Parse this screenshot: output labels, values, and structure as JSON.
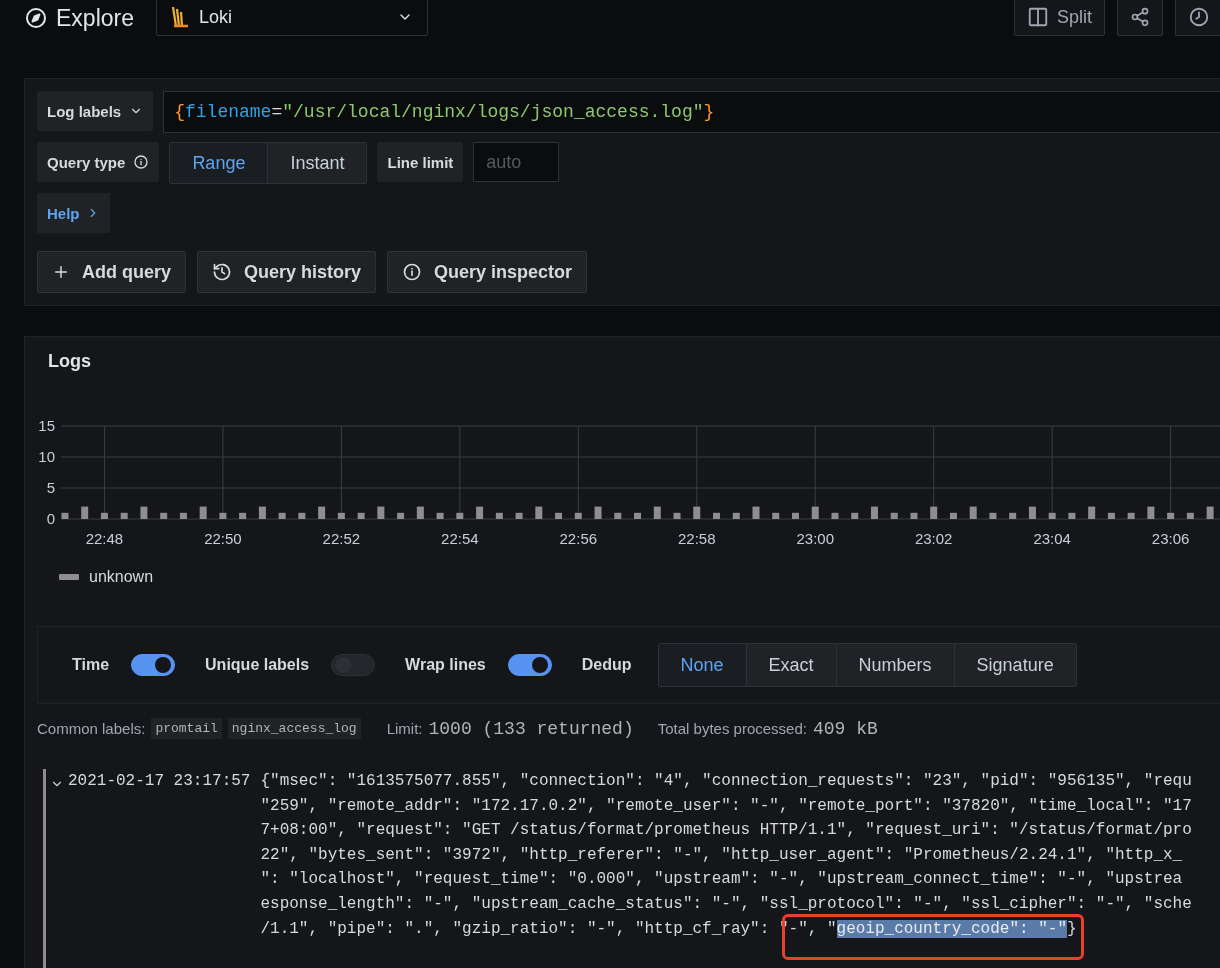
{
  "topbar": {
    "title": "Explore",
    "datasource": "Loki",
    "actions": [
      {
        "kind": "split",
        "label": "Split"
      },
      {
        "kind": "share"
      },
      {
        "kind": "clock"
      }
    ]
  },
  "query": {
    "labels_button": "Log labels",
    "expression": [
      {
        "kind": "brace",
        "text": "{"
      },
      {
        "kind": "key",
        "text": "filename"
      },
      {
        "kind": "op",
        "text": "="
      },
      {
        "kind": "string",
        "text": "\"/usr/local/nginx/logs/json_access.log\""
      },
      {
        "kind": "brace",
        "text": "}"
      }
    ],
    "query_type_label": "Query type",
    "query_types": [
      {
        "label": "Range",
        "selected": true
      },
      {
        "label": "Instant",
        "selected": false
      }
    ],
    "line_limit_label": "Line limit",
    "line_limit_placeholder": "auto",
    "help": "Help"
  },
  "query_buttons": [
    {
      "kind": "add",
      "label": "Add query"
    },
    {
      "kind": "history",
      "label": "Query history"
    },
    {
      "kind": "info",
      "label": "Query inspector"
    }
  ],
  "logs": {
    "title": "Logs",
    "chart_data": {
      "type": "bar",
      "grid": true,
      "ylim": [
        0,
        15
      ],
      "yticks": [
        0,
        5,
        10,
        15
      ],
      "categories": [
        null,
        null,
        "22:48",
        null,
        null,
        null,
        null,
        null,
        "22:50",
        null,
        null,
        null,
        null,
        null,
        "22:52",
        null,
        null,
        null,
        null,
        null,
        "22:54",
        null,
        null,
        null,
        null,
        null,
        "22:56",
        null,
        null,
        null,
        null,
        null,
        "22:58",
        null,
        null,
        null,
        null,
        null,
        "23:00",
        null,
        null,
        null,
        null,
        null,
        "23:02",
        null,
        null,
        null,
        null,
        null,
        "23:04",
        null,
        null,
        null,
        null,
        null,
        "23:06",
        null,
        null
      ],
      "series": [
        {
          "name": "unknown",
          "color": "#8e8e8e",
          "values": [
            1,
            2,
            1,
            1,
            2,
            1,
            1,
            2,
            1,
            1,
            2,
            1,
            1,
            2,
            1,
            1,
            2,
            1,
            2,
            1,
            1,
            2,
            1,
            1,
            2,
            1,
            1,
            2,
            1,
            1,
            2,
            1,
            2,
            1,
            1,
            2,
            1,
            1,
            2,
            1,
            1,
            2,
            1,
            1,
            2,
            1,
            2,
            1,
            1,
            2,
            1,
            1,
            2,
            1,
            1,
            2,
            1,
            1,
            2
          ]
        }
      ]
    },
    "options": [
      {
        "label": "Time",
        "on": true
      },
      {
        "label": "Unique labels",
        "on": false
      },
      {
        "label": "Wrap lines",
        "on": true
      }
    ],
    "dedup_label": "Dedup",
    "dedup": [
      {
        "label": "None",
        "selected": true
      },
      {
        "label": "Exact",
        "selected": false
      },
      {
        "label": "Numbers",
        "selected": false
      },
      {
        "label": "Signature",
        "selected": false
      }
    ],
    "common_labels_label": "Common labels:",
    "common_labels": [
      "promtail",
      "nginx_access_log"
    ],
    "limit_label": "Limit:",
    "limit": "1000 (133 returned)",
    "bytes_label": "Total bytes processed:",
    "bytes": "409 kB",
    "rows": [
      {
        "timestamp": "2021-02-17 23:17:57",
        "lines": [
          {
            "segments": [
              {
                "text": "{\"msec\": \"1613575077.855\", \"connection\": \"4\", \"connection_requests\": \"23\", \"pid\": \"956135\", \"requ",
                "selected": false,
                "boxed": false
              }
            ]
          },
          {
            "segments": [
              {
                "text": "\"259\", \"remote_addr\": \"172.17.0.2\", \"remote_user\": \"-\", \"remote_port\": \"37820\", \"time_local\": \"17",
                "selected": false,
                "boxed": false
              }
            ]
          },
          {
            "segments": [
              {
                "text": "7+08:00\", \"request\": \"GET /status/format/prometheus HTTP/1.1\", \"request_uri\": \"/status/format/pro",
                "selected": false,
                "boxed": false
              }
            ]
          },
          {
            "segments": [
              {
                "text": "22\", \"bytes_sent\": \"3972\", \"http_referer\": \"-\", \"http_user_agent\": \"Prometheus/2.24.1\", \"http_x_",
                "selected": false,
                "boxed": false
              }
            ]
          },
          {
            "segments": [
              {
                "text": "\": \"localhost\", \"request_time\": \"0.000\", \"upstream\": \"-\", \"upstream_connect_time\": \"-\", \"upstrea",
                "selected": false,
                "boxed": false
              }
            ]
          },
          {
            "segments": [
              {
                "text": "esponse_length\": \"-\", \"upstream_cache_status\": \"-\", \"ssl_protocol\": \"-\", \"ssl_cipher\": \"-\", \"sche",
                "selected": false,
                "boxed": false
              }
            ]
          },
          {
            "segments": [
              {
                "text": "/1.1\", \"pipe\": \".\", \"gzip_ratio\": \"-\", \"http_cf_ray\": \"",
                "selected": false,
                "boxed": false
              },
              {
                "text": "-\", \"",
                "selected": false,
                "boxed": true
              },
              {
                "text": "geoip_country_code\": \"-\"",
                "selected": true,
                "boxed": true
              },
              {
                "text": "}",
                "selected": false,
                "boxed": true
              }
            ]
          }
        ]
      }
    ]
  }
}
